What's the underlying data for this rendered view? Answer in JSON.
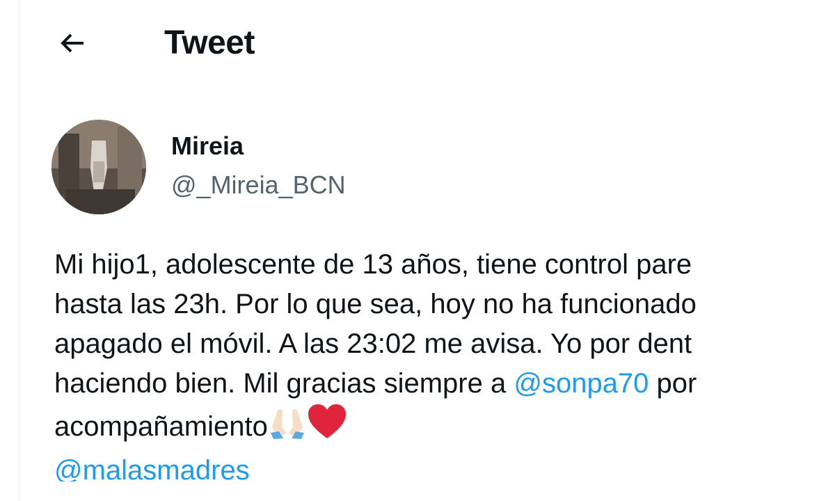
{
  "header": {
    "title": "Tweet",
    "back_icon": "arrow-left-icon"
  },
  "author": {
    "display_name": "Mireia",
    "handle": "@_Mireia_BCN",
    "avatar": "avatar-photo"
  },
  "tweet": {
    "line1": "Mi hijo1, adolescente de 13 años, tiene control pare",
    "line2": "hasta las 23h. Por lo que sea, hoy no ha funcionado",
    "line3": "apagado el móvil. A las 23:02 me avisa. Yo por dent",
    "line4_text": "haciendo bien. Mil gracias siempre a ",
    "line4_mention": "@sonpa70",
    "line4_after": " por",
    "line5_text": "acompañamiento",
    "line5_emojis": [
      "folded-hands-icon",
      "red-heart-icon"
    ],
    "line6_mention": "@malasmadres"
  },
  "colors": {
    "text": "#0f1419",
    "secondary": "#536471",
    "link": "#1d9bf0",
    "heart": "#e0243b"
  }
}
